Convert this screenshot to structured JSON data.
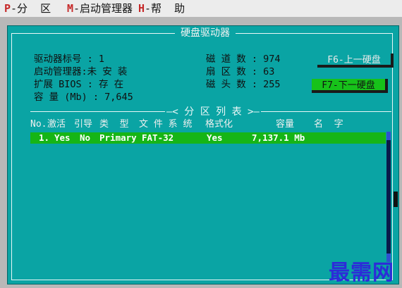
{
  "menu": [
    {
      "key": "P",
      "rest": "-分  区"
    },
    {
      "key": "M",
      "rest": "-启动管理器"
    },
    {
      "key": "H",
      "rest": "-帮  助"
    }
  ],
  "dialog": {
    "title": "硬盘驱动器",
    "info": {
      "drive_no": {
        "label": "驱动器标号",
        "value": "1"
      },
      "boot_mgr": {
        "label": "启动管理器",
        "value": "未 安 装"
      },
      "ext_bios": {
        "label": "扩展 BIOS",
        "value": "存 在"
      },
      "capacity": {
        "label": "容 量 (Mb)",
        "value": "7,645"
      },
      "tracks": {
        "label": "磁 道 数",
        "value": "974"
      },
      "sectors": {
        "label": "扇 区 数",
        "value": "63"
      },
      "heads": {
        "label": "磁 头 数",
        "value": "255"
      }
    },
    "buttons": {
      "prev": "F6-上一硬盘",
      "next": "F7-下一硬盘"
    },
    "table": {
      "title": "—< 分  区  列  表 >—",
      "headers": [
        "No.",
        "激活",
        "引导",
        "类  型",
        "文 件 系 统",
        "格式化",
        "容量",
        "名  字"
      ],
      "rows": [
        [
          "1.",
          "Yes",
          "No",
          "Primary",
          "FAT-32",
          "Yes",
          "7,137.1 Mb",
          ""
        ]
      ]
    }
  },
  "watermark": "最需网"
}
